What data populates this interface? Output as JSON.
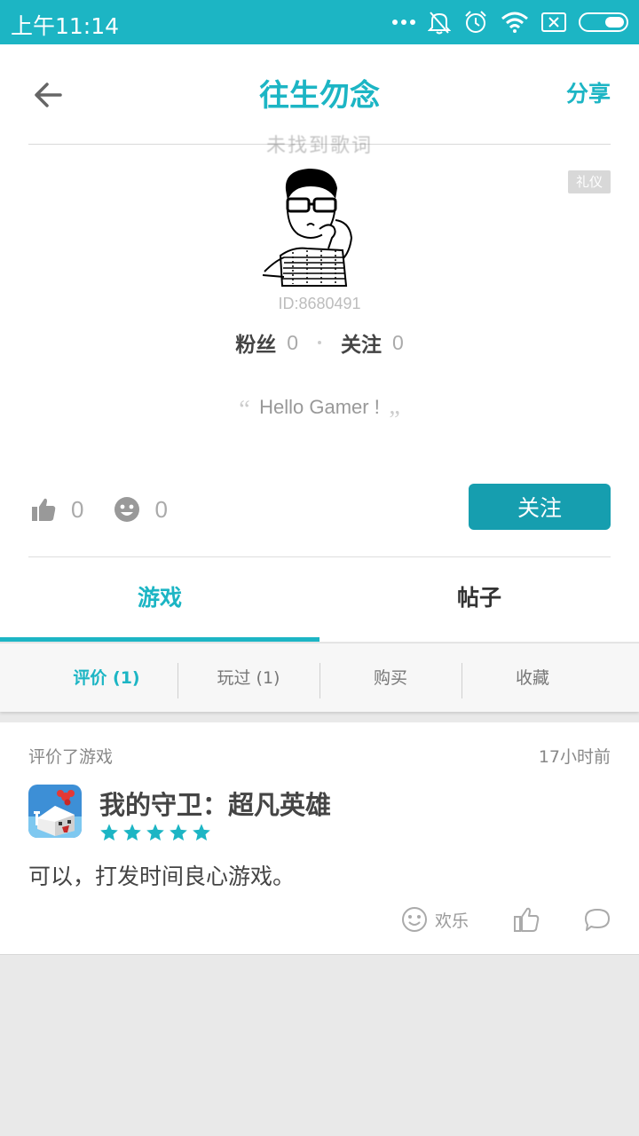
{
  "status_bar": {
    "time": "上午11:14"
  },
  "header": {
    "title": "往生勿念",
    "share_label": "分享"
  },
  "watermark_text": "未找到歌词",
  "badge": "礼仪",
  "profile": {
    "user_id": "ID:8680491",
    "fans_label": "粉丝",
    "fans_count": "0",
    "following_label": "关注",
    "following_count": "0",
    "motto": "Hello Gamer !",
    "open_quote": "“",
    "close_quote": "”",
    "likes": "0",
    "fun": "0",
    "follow_button": "关注"
  },
  "tabs": [
    {
      "label": "游戏"
    },
    {
      "label": "帖子"
    }
  ],
  "subtabs": [
    {
      "label": "评价 (1)"
    },
    {
      "label": "玩过 (1)"
    },
    {
      "label": "购买"
    },
    {
      "label": "收藏"
    }
  ],
  "review": {
    "action": "评价了游戏",
    "time": "17小时前",
    "game_name": "我的守卫：超凡英雄",
    "rating": 5,
    "comment": "可以，打发时间良心游戏。",
    "reaction_label": "欢乐"
  },
  "colors": {
    "accent": "#1cb5c4",
    "button": "#169eaf"
  },
  "icons": [
    "back-arrow-icon",
    "thumbs-up-icon",
    "smile-icon",
    "star-icon",
    "comment-icon"
  ]
}
